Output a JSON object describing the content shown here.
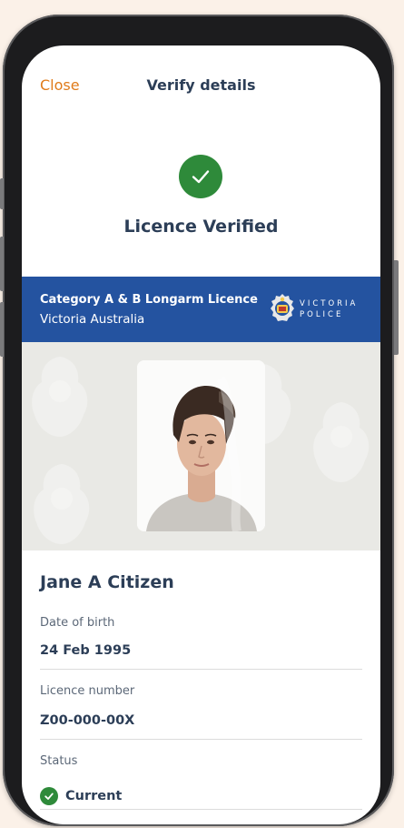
{
  "nav": {
    "close_label": "Close",
    "title": "Verify details"
  },
  "verification": {
    "title": "Licence Verified",
    "icon": "check-circle-icon",
    "color": "#2e8a3a"
  },
  "banner": {
    "title": "Category A & B Longarm Licence",
    "subtitle": "Victoria Australia",
    "logo_line1": "VICTORIA",
    "logo_line2": "POLICE",
    "color": "#2453a0"
  },
  "holder": {
    "name": "Jane A Citizen"
  },
  "fields": [
    {
      "label": "Date of birth",
      "value": "24 Feb 1995"
    },
    {
      "label": "Licence number",
      "value": "Z00-000-00X"
    },
    {
      "label": "Status",
      "value": "Current"
    }
  ],
  "colors": {
    "accent": "#e07b1a",
    "text": "#2c3e57",
    "success": "#2e8a3a"
  }
}
